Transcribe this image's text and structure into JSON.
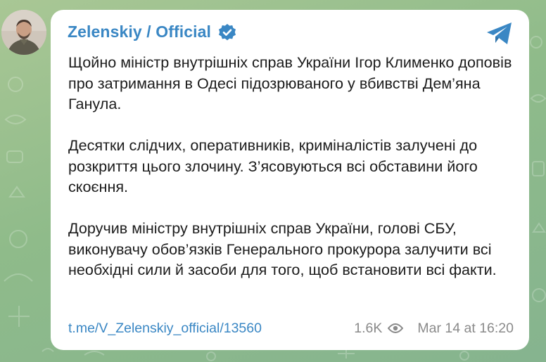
{
  "post": {
    "channel_name": "Zelenskiy / Official",
    "verified": true,
    "paragraphs": [
      "Щойно міністр внутрішніх справ України Ігор Клименко доповів про затримання в Одесі підозрюваного у вбивстві Дем’яна Ганула.",
      "Десятки слідчих, оперативників, криміналістів залучені до розкриття цього злочину. З’ясовуються всі обставини його скоєння.",
      "Доручив міністру внутрішніх справ України, голові СБУ, виконувачу обов’язків Генерального прокурора залучити всі необхідні сили й засоби для того, щоб встановити всі факти."
    ],
    "link": "t.me/V_Zelenskiy_official/13560",
    "views": "1.6K",
    "date": "Mar 14 at 16:20"
  },
  "icons": {
    "verified": "verified-badge-icon",
    "share": "telegram-share-icon",
    "views": "eye-icon",
    "avatar": "channel-avatar"
  },
  "colors": {
    "accent": "#3a87c4",
    "bubble": "#ffffff",
    "background": "#8fbb8a",
    "meta_text": "#8a8a8a"
  }
}
